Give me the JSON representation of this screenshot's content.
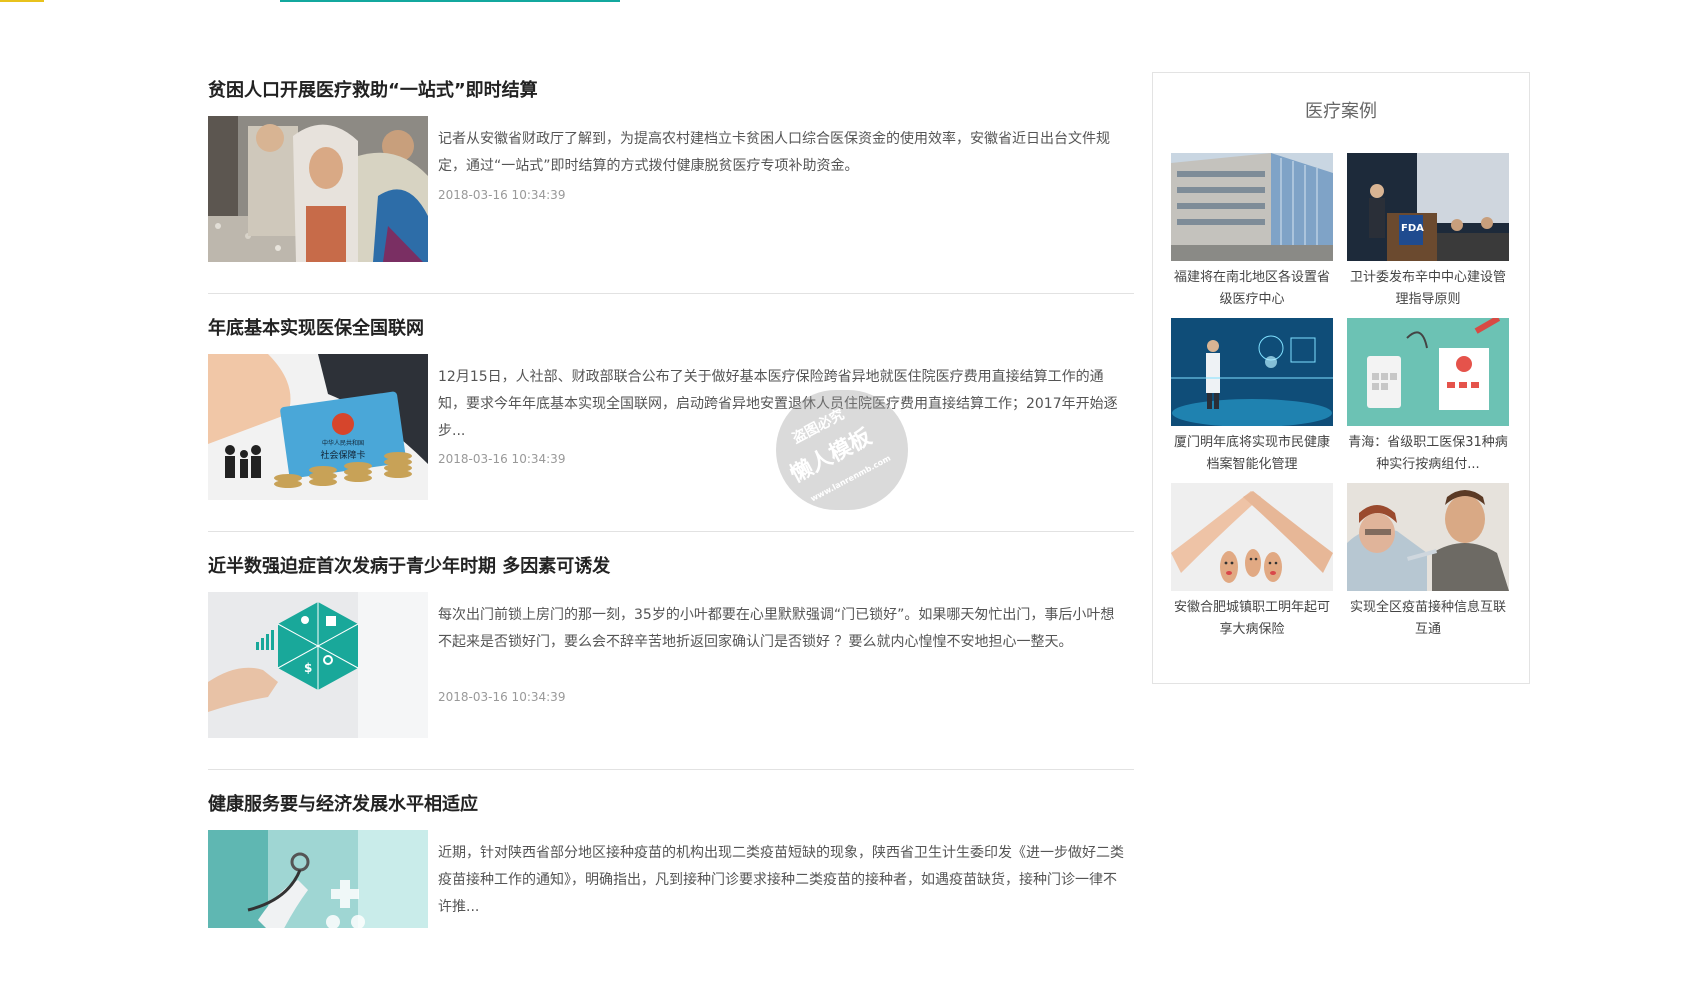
{
  "colors": {
    "accent_green": "#13a89e",
    "accent_yellow": "#e8c21c",
    "title": "#222222",
    "text": "#555555",
    "date": "#999999"
  },
  "articles": [
    {
      "title": "贫困人口开展医疗救助“一站式”即时结算",
      "summary": "记者从安徽省财政厅了解到，为提高农村建档立卡贫困人口综合医保资金的使用效率，安徽省近日出台文件规定，通过“一站式”即时结算的方式拨付健康脱贫医疗专项补助资金。",
      "date": "2018-03-16 10:34:39"
    },
    {
      "title": "年底基本实现医保全国联网",
      "summary": "12月15日，人社部、财政部联合公布了关于做好基本医疗保险跨省异地就医住院医疗费用直接结算工作的通知，要求今年年底基本实现全国联网，启动跨省异地安置退休人员住院医疗费用直接结算工作；2017年开始逐步...",
      "date": "2018-03-16 10:34:39"
    },
    {
      "title": "近半数强迫症首次发病于青少年时期 多因素可诱发",
      "summary": "每次出门前锁上房门的那一刻，35岁的小叶都要在心里默默强调“门已锁好”。如果哪天匆忙出门，事后小叶想不起来是否锁好门，要么会不辞辛苦地折返回家确认门是否锁好 ？要么就内心惶惶不安地担心一整天。",
      "date": "2018-03-16 10:34:39"
    },
    {
      "title": "健康服务要与经济发展水平相适应",
      "summary": "近期，针对陕西省部分地区接种疫苗的机构出现二类疫苗短缺的现象，陕西省卫生计生委印发《进一步做好二类疫苗接种工作的通知》，明确指出，凡到接种门诊要求接种二类疫苗的接种者，如遇疫苗缺货，接种门诊一律不许推...",
      "date": ""
    }
  ],
  "sidebar": {
    "title": "医疗案例",
    "cases": [
      {
        "caption": "福建将在南北地区各设置省级医疗中心"
      },
      {
        "caption": "卫计委发布辛中中心建设管理指导原则"
      },
      {
        "caption": "厦门明年底将实现市民健康档案智能化管理"
      },
      {
        "caption": "青海：省级职工医保31种病种实行按病组付..."
      },
      {
        "caption": "安徽合肥城镇职工明年起可享大病保险"
      },
      {
        "caption": "实现全区疫苗接种信息互联互通"
      }
    ]
  },
  "watermark": {
    "line1": "盗图必究",
    "line2": "懒人模板",
    "line3": "www.lanrenmb.com"
  },
  "image_text": {
    "fda": "FDA",
    "card": "社会保障卡",
    "card_top": "中华人民共和国"
  }
}
